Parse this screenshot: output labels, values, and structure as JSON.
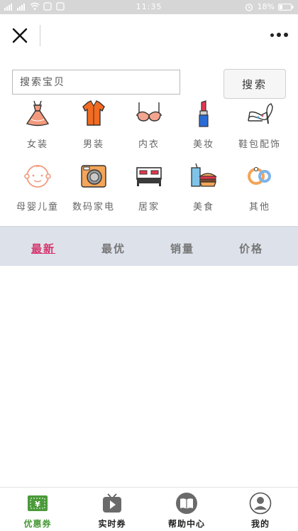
{
  "status_bar": {
    "time": "11:35",
    "battery": "18%"
  },
  "search": {
    "placeholder": "搜索宝贝",
    "button_label": "搜索"
  },
  "categories": [
    {
      "label": "女装",
      "icon": "dress-icon"
    },
    {
      "label": "男装",
      "icon": "shirt-icon"
    },
    {
      "label": "内衣",
      "icon": "bra-icon"
    },
    {
      "label": "美妆",
      "icon": "lipstick-icon"
    },
    {
      "label": "鞋包配饰",
      "icon": "high-heel-icon"
    },
    {
      "label": "母婴儿童",
      "icon": "baby-icon"
    },
    {
      "label": "数码家电",
      "icon": "camera-icon"
    },
    {
      "label": "居家",
      "icon": "bed-icon"
    },
    {
      "label": "美食",
      "icon": "food-icon"
    },
    {
      "label": "其他",
      "icon": "rings-icon"
    }
  ],
  "sort_tabs": [
    {
      "label": "最新",
      "active": true
    },
    {
      "label": "最优",
      "active": false
    },
    {
      "label": "销量",
      "active": false
    },
    {
      "label": "价格",
      "active": false
    }
  ],
  "bottom_tabs": [
    {
      "label": "优惠券",
      "icon": "coupon-icon",
      "active": true
    },
    {
      "label": "实时券",
      "icon": "play-tv-icon",
      "active": false
    },
    {
      "label": "帮助中心",
      "icon": "book-icon",
      "active": false
    },
    {
      "label": "我的",
      "icon": "user-icon",
      "active": false
    }
  ],
  "colors": {
    "accent": "#d6336c",
    "active_tab": "#4a9a3a",
    "sortbar_bg": "#dde1ea"
  }
}
